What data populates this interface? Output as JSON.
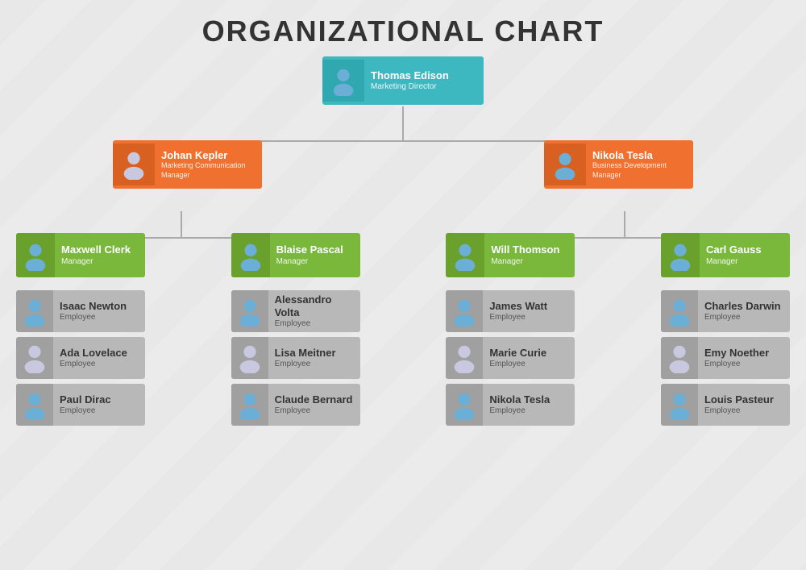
{
  "title": "ORGANIZATIONAL CHART",
  "colors": {
    "teal": "#3db8c0",
    "teal_dark": "#2fa8b0",
    "orange": "#f07030",
    "orange_dark": "#d86020",
    "green": "#7ab83c",
    "green_dark": "#6aa02c",
    "gray": "#b8b8b8",
    "gray_dark": "#a0a0a0",
    "connector": "#aaaaaa"
  },
  "nodes": {
    "level1": {
      "name": "Thomas Edison",
      "role": "Marketing Director"
    },
    "level2": [
      {
        "name": "Johan Kepler",
        "role": "Marketing Communication Manager"
      },
      {
        "name": "Nikola Tesla",
        "role": "Business Development Manager"
      }
    ],
    "level3": [
      {
        "name": "Maxwell Clerk",
        "role": "Manager"
      },
      {
        "name": "Blaise Pascal",
        "role": "Manager"
      },
      {
        "name": "Will Thomson",
        "role": "Manager"
      },
      {
        "name": "Carl Gauss",
        "role": "Manager"
      }
    ],
    "level4": [
      [
        {
          "name": "Isaac Newton",
          "role": "Employee"
        },
        {
          "name": "Ada Lovelace",
          "role": "Employee"
        },
        {
          "name": "Paul Dirac",
          "role": "Employee"
        }
      ],
      [
        {
          "name": "Alessandro Volta",
          "role": "Employee"
        },
        {
          "name": "Lisa Meitner",
          "role": "Employee"
        },
        {
          "name": "Claude Bernard",
          "role": "Employee"
        }
      ],
      [
        {
          "name": "James Watt",
          "role": "Employee"
        },
        {
          "name": "Marie Curie",
          "role": "Employee"
        },
        {
          "name": "Nikola Tesla",
          "role": "Employee"
        }
      ],
      [
        {
          "name": "Charles Darwin",
          "role": "Employee"
        },
        {
          "name": "Emy Noether",
          "role": "Employee"
        },
        {
          "name": "Louis Pasteur",
          "role": "Employee"
        }
      ]
    ]
  }
}
